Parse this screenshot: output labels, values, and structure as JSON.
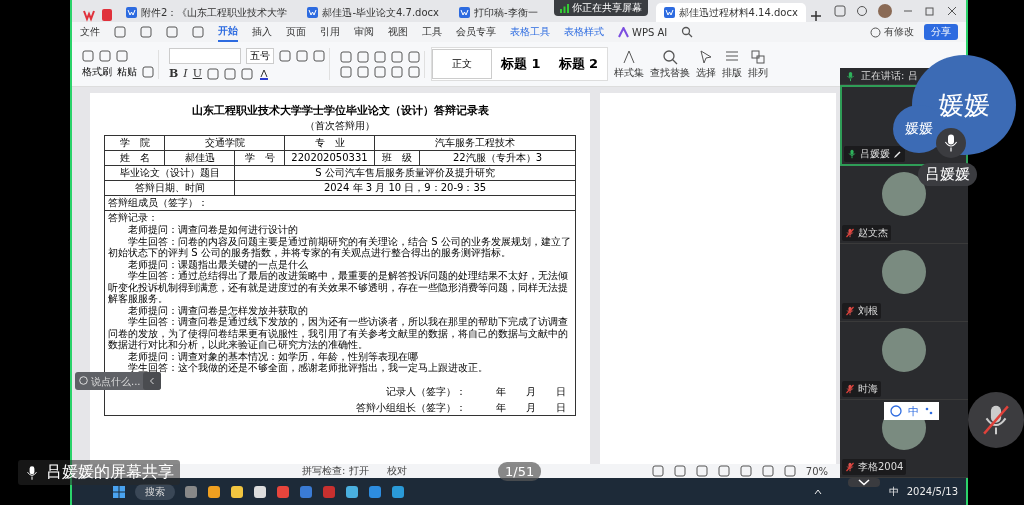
{
  "window": {
    "doc_tabs": [
      {
        "title": "附件2：《山东工程职业技术大学",
        "selected": false
      },
      {
        "title": "郝佳迅-毕业论文4.7.docx",
        "selected": false
      },
      {
        "title": "打印稿-李衡一",
        "selected": false
      },
      {
        "title": "郝佳迅过程材料4.14.docx",
        "selected": true
      }
    ],
    "share_notice": "你正在共享屏幕",
    "file_menu": "文件",
    "menu_tabs": [
      {
        "label": "开始",
        "kind": "tab",
        "selected": true
      },
      {
        "label": "插入",
        "kind": "tab",
        "selected": false
      },
      {
        "label": "页面",
        "kind": "tab",
        "selected": false
      },
      {
        "label": "引用",
        "kind": "tab",
        "selected": false
      },
      {
        "label": "审阅",
        "kind": "tab",
        "selected": false
      },
      {
        "label": "视图",
        "kind": "tab",
        "selected": false
      },
      {
        "label": "工具",
        "kind": "tab",
        "selected": false
      },
      {
        "label": "会员专享",
        "kind": "tab",
        "selected": false
      },
      {
        "label": "表格工具",
        "kind": "context",
        "selected": false
      },
      {
        "label": "表格样式",
        "kind": "context",
        "selected": false
      },
      {
        "label": "WPS AI",
        "kind": "ai",
        "selected": false
      }
    ],
    "modified": "有修改",
    "share_button": "分享"
  },
  "ribbon": {
    "format_painter": "格式刷",
    "paste": "粘贴",
    "font_size": "五号",
    "format_buttons": [
      "B",
      "I",
      "U"
    ],
    "styles": [
      {
        "label": "正文",
        "selected": true
      },
      {
        "label": "标题 1",
        "selected": false
      },
      {
        "label": "标题 2",
        "selected": false
      }
    ],
    "style_set": "样式集",
    "find_replace": "查找替换",
    "select": "选择",
    "layout": "排版",
    "arrange": "排列"
  },
  "document": {
    "title": "山东工程职业技术大学学士学位毕业论文（设计）答辩记录表",
    "subtitle": "（首次答辩用）",
    "table": {
      "fields": [
        {
          "label": "学　院",
          "value": "交通学院"
        },
        {
          "label": "专　业",
          "value": "汽车服务工程技术"
        },
        {
          "label": "姓　名",
          "value": "郝佳迅"
        },
        {
          "label": "学　号",
          "value": "220202050331"
        },
        {
          "label": "班　级",
          "value": "22汽服（专升本）3"
        },
        {
          "label": "毕业论文（设计）题目",
          "value": "S 公司汽车售后服务质量评价及提升研究"
        },
        {
          "label": "答辩日期、时间",
          "value": "2024 年 3 月 10 日，9：20-9：35"
        }
      ],
      "members_label": "答辩组成员（签字）：",
      "record_label": "答辩记录：",
      "record": [
        "老师提问：调查问卷是如何进行设计的",
        "学生回答：问卷的内容及问题主要是通过前期研究的有关理论，结合 S 公司的业务发展规划，建立了初始状态下的评判 S 公司的服务指数，并将专家的有关观点进行整合得出的服务测评指标。",
        "老师提问：课题指出最关键的一点是什么",
        "学生回答：通过总结得出了最后的改进策略中，最重要的是解答投诉问题的处理结果不太好，无法倾听变化投诉机制得到满意，还有就是进度过的有关效果不够透明，存在一些隐形消费等问题，同样无法提解客服服务。",
        "老师提问：调查问卷是怎样发放并获取的",
        "学生回答：调查问卷是通过线下发放的，因为还有一些访谈者，所以我在那里的帮助下完成了访调查问卷的发放，为了使得问卷结果更有说服性，我引用了有关参考文献里的数据，将自己的数据与文献中的数据进行对比和分析，以此来验证自己研究方法的准确性。",
        "老师提问：调查对象的基本情况：如学历，年龄，性别等表现在哪",
        "学生回答：这个我做的还是不够全面，感谢老师批评指出，我一定马上跟进改正。"
      ],
      "signatures": [
        {
          "label": "记录人（签字）：",
          "date": "年　　月　　日"
        },
        {
          "label": "答辩小组组长（签字）：",
          "date": "年　　月　　日"
        }
      ]
    }
  },
  "status_bar": {
    "spell_check": "拼写检查: 打开",
    "proofread": "校对",
    "zoom": "70%",
    "page": "1/51"
  },
  "chat_input": {
    "placeholder": "说点什么..."
  },
  "meeting": {
    "speaking": "正在讲话: 吕",
    "participants": [
      {
        "name": "吕媛媛",
        "muted": false,
        "speaking": true,
        "avatar": false,
        "self": true
      },
      {
        "name": "赵文杰",
        "muted": true,
        "speaking": false,
        "avatar": true,
        "self": false
      },
      {
        "name": "刘根",
        "muted": true,
        "speaking": false,
        "avatar": true,
        "self": false
      },
      {
        "name": "时海",
        "muted": true,
        "speaking": false,
        "avatar": true,
        "self": false
      },
      {
        "name": "李格2004",
        "muted": true,
        "speaking": false,
        "avatar": true,
        "self": false
      }
    ],
    "bubble": "媛媛",
    "small_bubble": "媛媛",
    "speaker_name": "吕媛媛",
    "share_label": "吕媛媛的屏幕共享",
    "self_muted": true
  },
  "ime_bar": {
    "mode": "中"
  },
  "taskbar": {
    "search": "搜索",
    "ime": "中",
    "date": "2024/5/13"
  }
}
